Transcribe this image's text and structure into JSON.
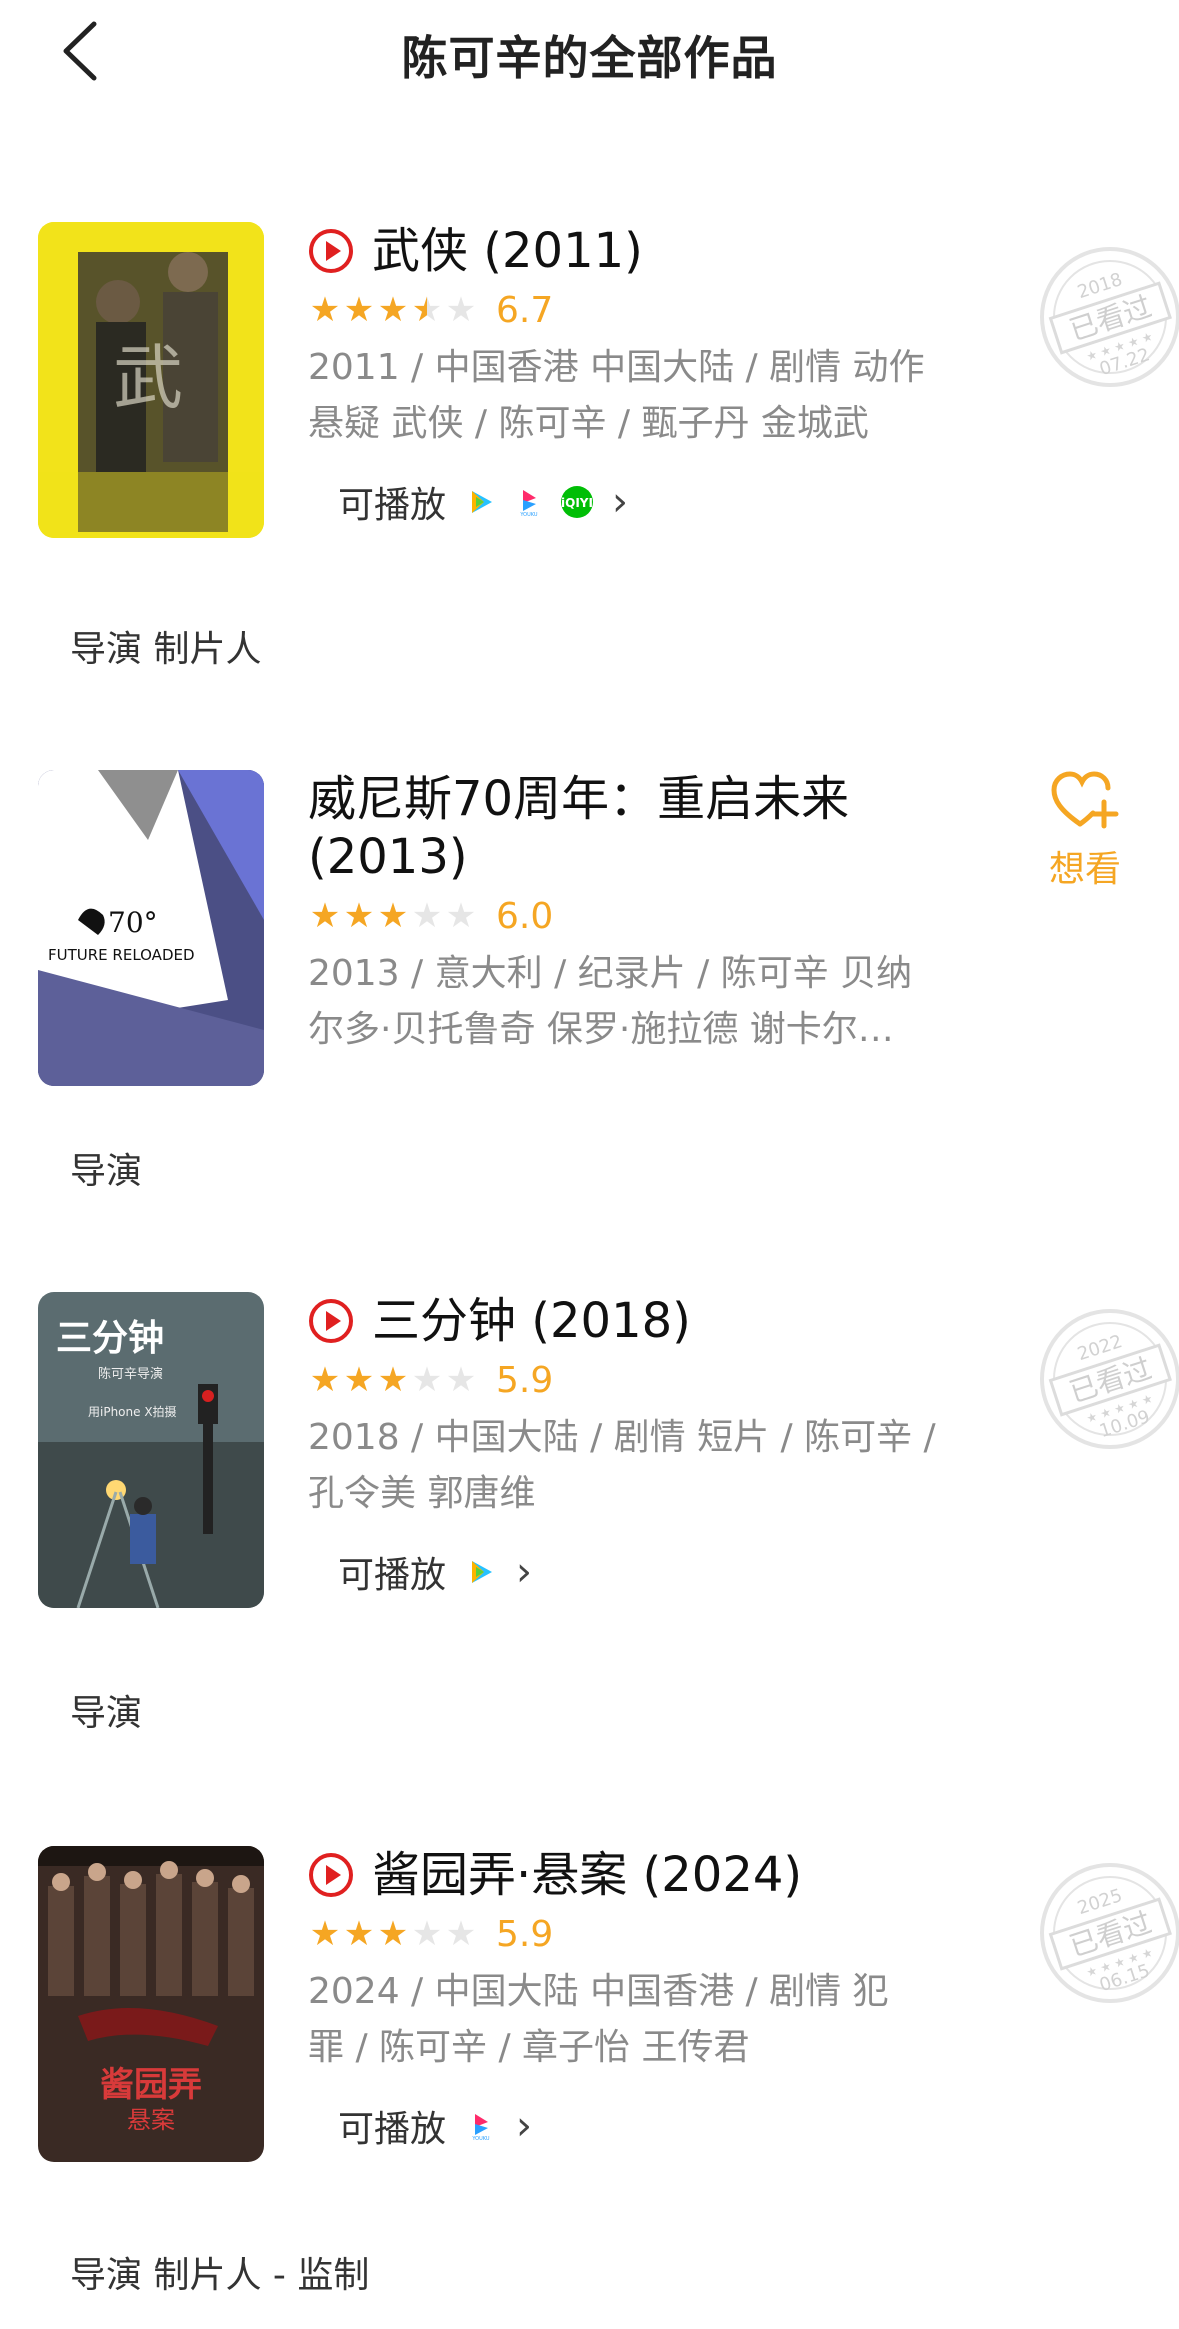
{
  "header": {
    "title": "陈可辛的全部作品"
  },
  "films": [
    {
      "title": "武侠 (2011)",
      "score": "6.7",
      "stars": [
        1,
        1,
        1,
        0.5,
        0
      ],
      "meta_line1": "2011 / 中国香港 中国大陆 / 剧情 动作",
      "meta_line2": "悬疑 武侠 / 陈可辛 / 甄子丹 金城武",
      "playable_label": "可播放",
      "platforms": [
        "tencent-video-icon",
        "youku-icon",
        "iqiyi-icon"
      ],
      "roles": "导演 制片人",
      "stamp": {
        "year": "2018",
        "text": "已看过",
        "date": "07.22"
      }
    },
    {
      "title": "威尼斯70周年：重启未来",
      "title2": "(2013)",
      "score": "6.0",
      "stars": [
        1,
        1,
        1,
        0,
        0
      ],
      "meta_line1": "2013 / 意大利 / 纪录片 / 陈可辛 贝纳",
      "meta_line2": "尔多·贝托鲁奇 保罗·施拉德 谢卡尔…",
      "poster_text": "FUTURE RELOADED",
      "poster_mark": "70°",
      "want_label": "想看",
      "roles": "导演"
    },
    {
      "title": "三分钟 (2018)",
      "score": "5.9",
      "stars": [
        1,
        1,
        1,
        0,
        0
      ],
      "meta_line1": "2018 / 中国大陆 / 剧情 短片 / 陈可辛 /",
      "meta_line2": "孔令美 郭唐维",
      "playable_label": "可播放",
      "platforms": [
        "tencent-video-icon"
      ],
      "poster_title": "三分钟",
      "poster_sub1": "陈可辛导演",
      "poster_sub2": "用iPhone X拍摄",
      "roles": "导演",
      "stamp": {
        "year": "2022",
        "text": "已看过",
        "date": "10.09"
      }
    },
    {
      "title": "酱园弄·悬案 (2024)",
      "score": "5.9",
      "stars": [
        1,
        1,
        1,
        0,
        0
      ],
      "meta_line1": "2024 / 中国大陆 中国香港 / 剧情 犯",
      "meta_line2": "罪 / 陈可辛 / 章子怡 王传君",
      "playable_label": "可播放",
      "platforms": [
        "youku-icon"
      ],
      "poster_title": "酱园弄",
      "poster_sub": "悬案",
      "roles": "导演 制片人 - 监制",
      "stamp": {
        "year": "2025",
        "text": "已看过",
        "date": "06.15"
      }
    }
  ],
  "colors": {
    "accent": "#f5a623",
    "play_red": "#e02020",
    "meta": "#8a8a8a"
  }
}
